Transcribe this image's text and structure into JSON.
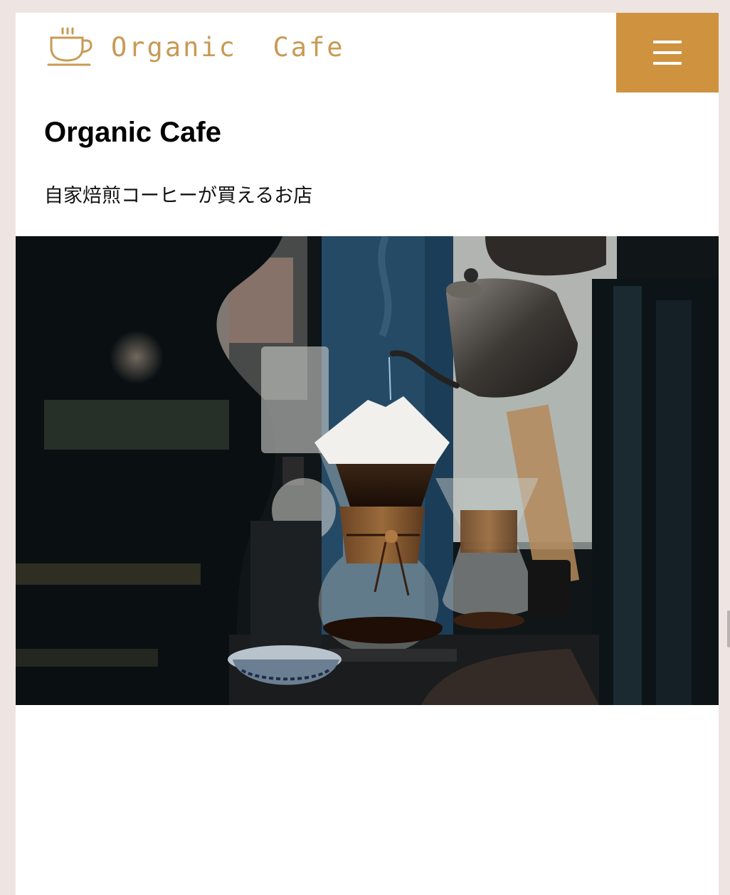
{
  "header": {
    "logo_text": "Organic  Cafe",
    "logo_icon": "coffee-cup-icon",
    "menu_icon": "hamburger-menu-icon",
    "accent_color": "#cf923f",
    "logo_color": "#c99a55"
  },
  "main": {
    "title": "Organic Cafe",
    "subtitle": "自家焙煎コーヒーが買えるお店"
  },
  "hero": {
    "image": "pour-over-coffee-photo"
  },
  "colors": {
    "page_background": "#eee5e3",
    "content_background": "#ffffff"
  }
}
